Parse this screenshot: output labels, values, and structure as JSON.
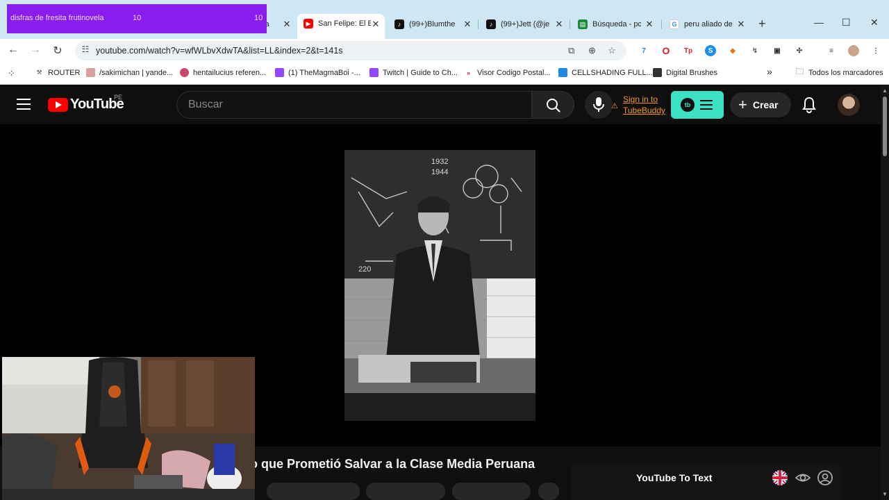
{
  "overlay": {
    "text": "disfras de fresita frutinovela",
    "count_a": "10",
    "count_b": "10"
  },
  "tabs": [
    {
      "title": "sa",
      "active": false
    },
    {
      "title": "San Felipe: El E",
      "active": true
    },
    {
      "title": "(99+)Blumthe",
      "active": false
    },
    {
      "title": "(99+)Jett (@je",
      "active": false
    },
    {
      "title": "Búsqueda - pc",
      "active": false
    },
    {
      "title": "peru aliado de",
      "active": false
    }
  ],
  "address_bar": {
    "url": "youtube.com/watch?v=wfWLbvXdwTA&list=LL&index=2&t=141s"
  },
  "bookmarks": [
    "ROUTER",
    "/sakimichan | yande...",
    "hentailucius referen...",
    "(1) TheMagmaBoi -...",
    "Twitch | Guide to Ch...",
    "Visor Codigo Postal...",
    "CELLSHADING FULL...",
    "Digital Brushes"
  ],
  "bookmarks_more": "»",
  "all_bookmarks": "Todos los marcadores",
  "youtube": {
    "logo_text": "YouTube",
    "country_code": "PE",
    "search_placeholder": "Buscar",
    "tubebuddy_line1": "Sign in to",
    "tubebuddy_line2": "TubeBuddy",
    "tubebuddy_badge": "tb",
    "create_label": "Crear",
    "video_title": "o que Prometió Salvar a la Clase Media Peruana",
    "yt_to_text_title": "YouTube To Text"
  },
  "video_frame": {
    "board_text_1": "1932",
    "board_text_2": "1944",
    "board_text_3": "220"
  },
  "colors": {
    "youtube_red": "#ff0000",
    "tubebuddy_teal": "#3ce0c2",
    "tubebuddy_orange": "#f29a20",
    "overlay_purple": "#8a1cf0",
    "page_bg": "#0f0f0f"
  }
}
